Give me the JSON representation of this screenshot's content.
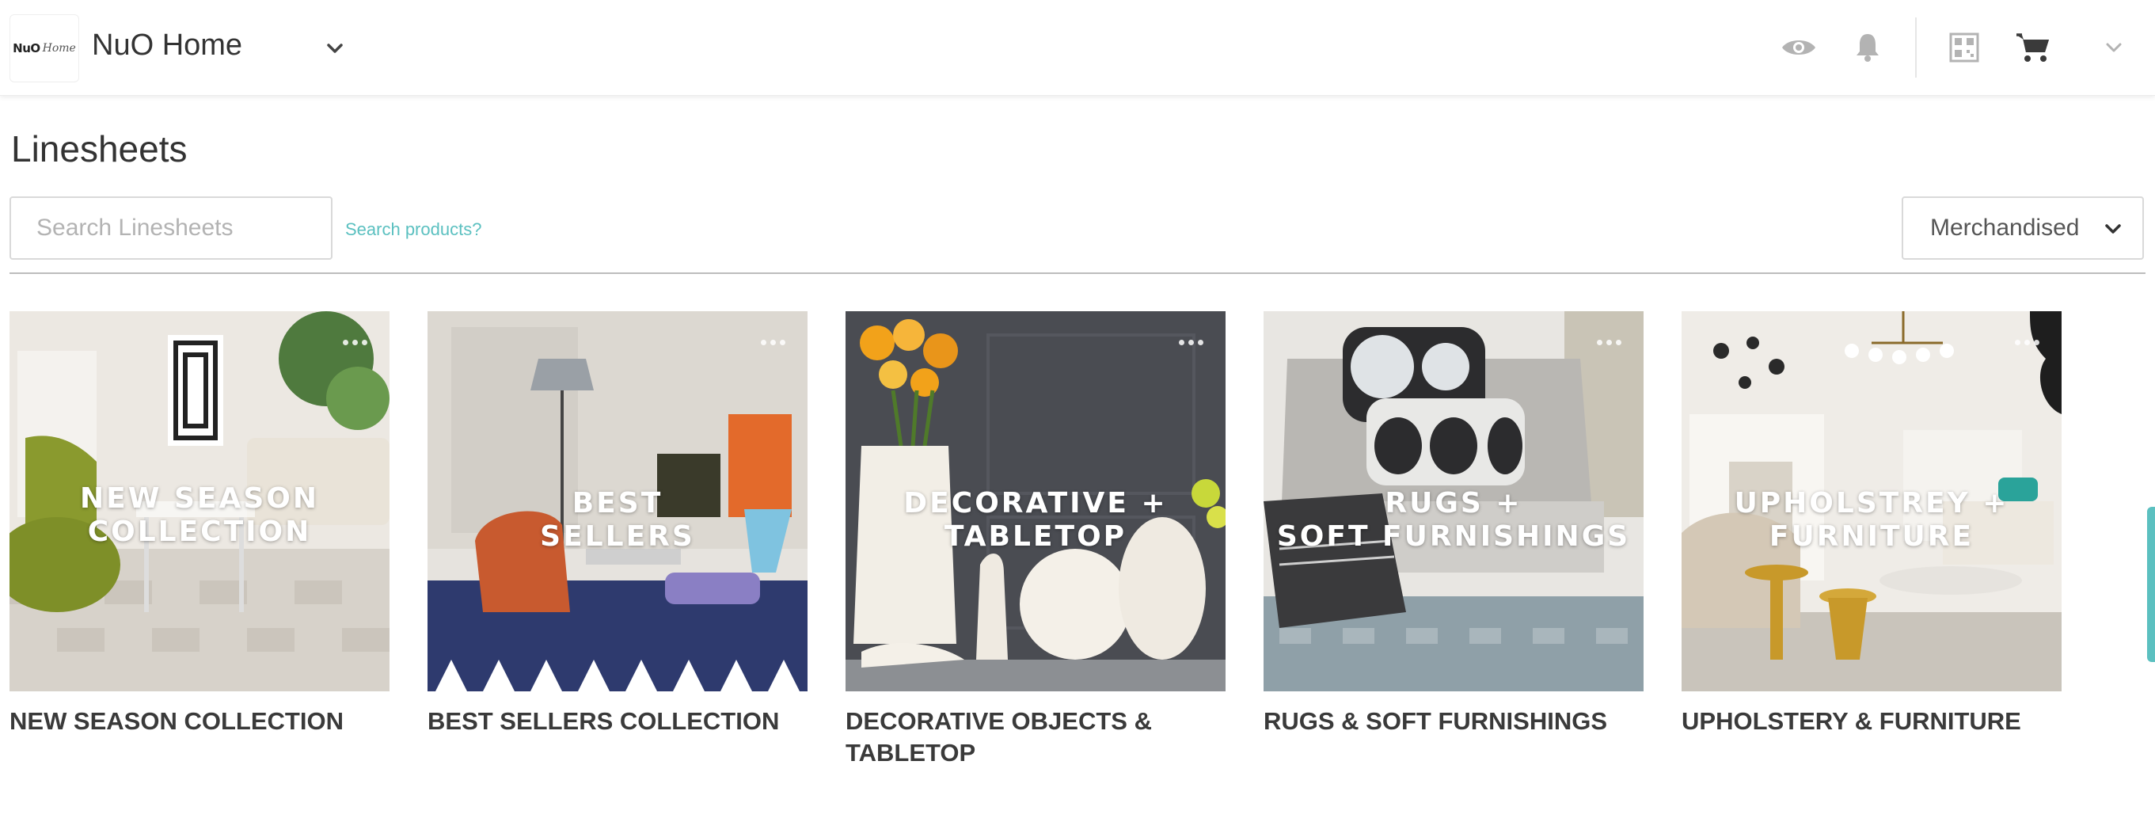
{
  "header": {
    "logo_word": "NuO",
    "logo_script": "Home",
    "brand_name": "NuO Home",
    "icons": [
      "chevron-down-icon",
      "eye-icon",
      "bell-icon",
      "qr-code-icon",
      "cart-icon",
      "chevron-down-icon"
    ]
  },
  "page": {
    "title": "Linesheets",
    "search_placeholder": "Search Linesheets",
    "search_link": "Search products?",
    "sort_label": "Merchandised"
  },
  "linesheets": [
    {
      "overlay": "NEW SEASON\nCOLLECTION",
      "title": "NEW SEASON COLLECTION"
    },
    {
      "overlay": "BEST\nSELLERS",
      "title": "BEST SELLERS COLLECTION"
    },
    {
      "overlay": "DECORATIVE +\nTABLETOP",
      "title": "DECORATIVE OBJECTS & TABLETOP"
    },
    {
      "overlay": "RUGS +\nSOFT FURNISHINGS",
      "title": "RUGS & SOFT FURNISHINGS"
    },
    {
      "overlay": "UPHOLSTREY +\nFURNITURE",
      "title": "UPHOLSTERY & FURNITURE"
    }
  ],
  "colors": {
    "accent": "#5bc0c0",
    "text": "#333333",
    "border": "#d9d9d9",
    "icon": "#b0b0b0"
  }
}
